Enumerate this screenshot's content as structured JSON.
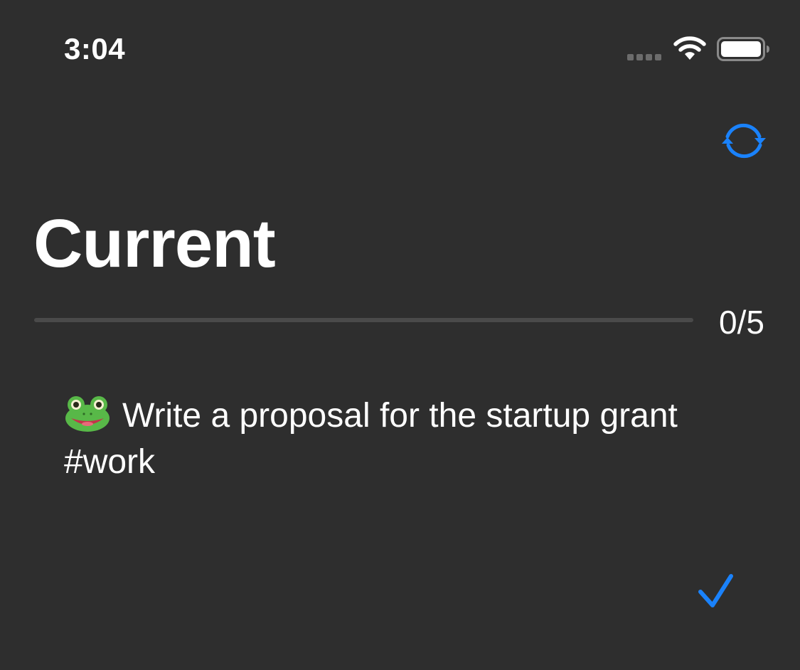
{
  "status_bar": {
    "time": "3:04"
  },
  "header": {
    "title": "Current"
  },
  "progress": {
    "completed": 0,
    "total": 5,
    "label": "0/5",
    "fraction": 0
  },
  "task": {
    "icon": "frog-emoji-icon",
    "text": "Write a proposal for the startup grant #work"
  },
  "colors": {
    "background": "#2e2e2e",
    "accent": "#1a82fb",
    "text": "#ffffff",
    "track": "#4a4a4a"
  },
  "icons": {
    "refresh": "refresh-icon",
    "complete": "checkmark-icon",
    "wifi": "wifi-icon",
    "battery": "battery-icon",
    "signal": "cellular-signal-icon"
  }
}
